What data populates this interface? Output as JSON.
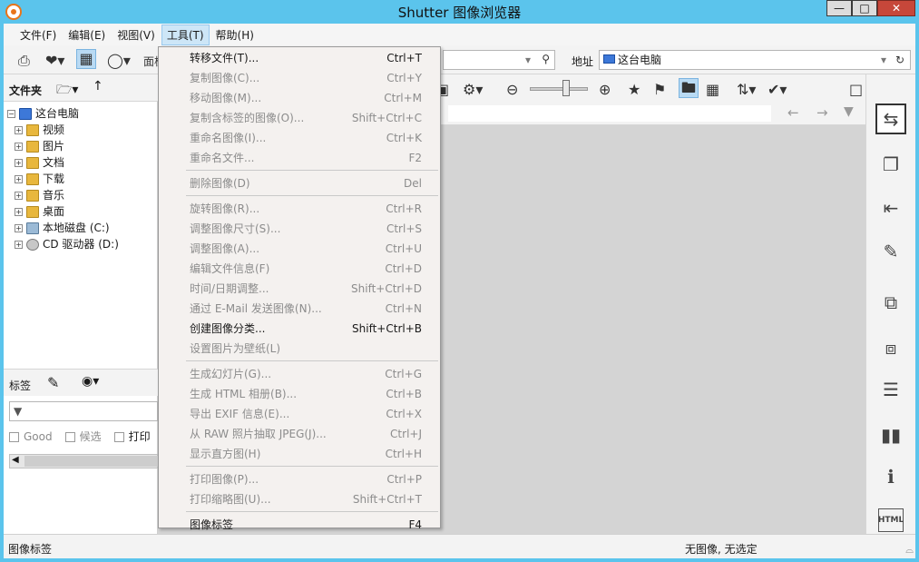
{
  "window": {
    "title": "Shutter 图像浏览器"
  },
  "menubar": {
    "items": [
      {
        "label": "文件(F)"
      },
      {
        "label": "编辑(E)"
      },
      {
        "label": "视图(V)"
      },
      {
        "label": "工具(T)",
        "active": true
      },
      {
        "label": "帮助(H)"
      }
    ]
  },
  "toolbar": {
    "address_label": "地址",
    "address_value": "这台电脑",
    "hidden_label": "面板"
  },
  "folders": {
    "header": "文件夹",
    "tree": [
      {
        "label": "这台电脑",
        "icon": "pc-icon",
        "level": 0
      },
      {
        "label": "视频",
        "icon": "video-folder-icon",
        "level": 1
      },
      {
        "label": "图片",
        "icon": "pictures-folder-icon",
        "level": 1
      },
      {
        "label": "文档",
        "icon": "documents-folder-icon",
        "level": 1
      },
      {
        "label": "下载",
        "icon": "downloads-folder-icon",
        "level": 1
      },
      {
        "label": "音乐",
        "icon": "music-folder-icon",
        "level": 1
      },
      {
        "label": "桌面",
        "icon": "desktop-folder-icon",
        "level": 1
      },
      {
        "label": "本地磁盘 (C:)",
        "icon": "drive-icon",
        "level": 1
      },
      {
        "label": "CD 驱动器 (D:)",
        "icon": "cd-drive-icon",
        "level": 1
      }
    ]
  },
  "tags": {
    "header": "标签",
    "checks": [
      "Good",
      "候选",
      "打印"
    ]
  },
  "tools_menu": {
    "items": [
      {
        "label": "转移文件(T)...",
        "shortcut": "Ctrl+T",
        "enabled": true
      },
      {
        "label": "复制图像(C)...",
        "shortcut": "Ctrl+Y",
        "enabled": false
      },
      {
        "label": "移动图像(M)...",
        "shortcut": "Ctrl+M",
        "enabled": false
      },
      {
        "label": "复制含标签的图像(O)...",
        "shortcut": "Shift+Ctrl+C",
        "enabled": false
      },
      {
        "label": "重命名图像(I)...",
        "shortcut": "Ctrl+K",
        "enabled": false
      },
      {
        "label": "重命名文件...",
        "shortcut": "F2",
        "enabled": false
      },
      {
        "separator": true
      },
      {
        "label": "删除图像(D)",
        "shortcut": "Del",
        "enabled": false
      },
      {
        "separator": true
      },
      {
        "label": "旋转图像(R)...",
        "shortcut": "Ctrl+R",
        "enabled": false
      },
      {
        "label": "调整图像尺寸(S)...",
        "shortcut": "Ctrl+S",
        "enabled": false
      },
      {
        "label": "调整图像(A)...",
        "shortcut": "Ctrl+U",
        "enabled": false
      },
      {
        "label": "编辑文件信息(F)",
        "shortcut": "Ctrl+D",
        "enabled": false
      },
      {
        "label": "时间/日期调整...",
        "shortcut": "Shift+Ctrl+D",
        "enabled": false
      },
      {
        "label": "通过 E-Mail 发送图像(N)...",
        "shortcut": "Ctrl+N",
        "enabled": false
      },
      {
        "label": "创建图像分类...",
        "shortcut": "Shift+Ctrl+B",
        "enabled": true
      },
      {
        "label": "设置图片为壁纸(L)",
        "shortcut": "",
        "enabled": false
      },
      {
        "separator": true
      },
      {
        "label": "生成幻灯片(G)...",
        "shortcut": "Ctrl+G",
        "enabled": false
      },
      {
        "label": "生成 HTML 相册(B)...",
        "shortcut": "Ctrl+B",
        "enabled": false
      },
      {
        "label": "导出 EXIF 信息(E)...",
        "shortcut": "Ctrl+X",
        "enabled": false
      },
      {
        "label": "从 RAW 照片抽取 JPEG(J)...",
        "shortcut": "Ctrl+J",
        "enabled": false
      },
      {
        "label": "显示直方图(H)",
        "shortcut": "Ctrl+H",
        "enabled": false
      },
      {
        "separator": true
      },
      {
        "label": "打印图像(P)...",
        "shortcut": "Ctrl+P",
        "enabled": false
      },
      {
        "label": "打印缩略图(U)...",
        "shortcut": "Shift+Ctrl+T",
        "enabled": false
      },
      {
        "separator": true
      },
      {
        "label": "图像标签",
        "shortcut": "F4",
        "enabled": true
      }
    ]
  },
  "statusbar": {
    "left": "图像标签",
    "right": "无图像, 无选定"
  },
  "right_sidebar": {
    "html_label": "HTML"
  }
}
